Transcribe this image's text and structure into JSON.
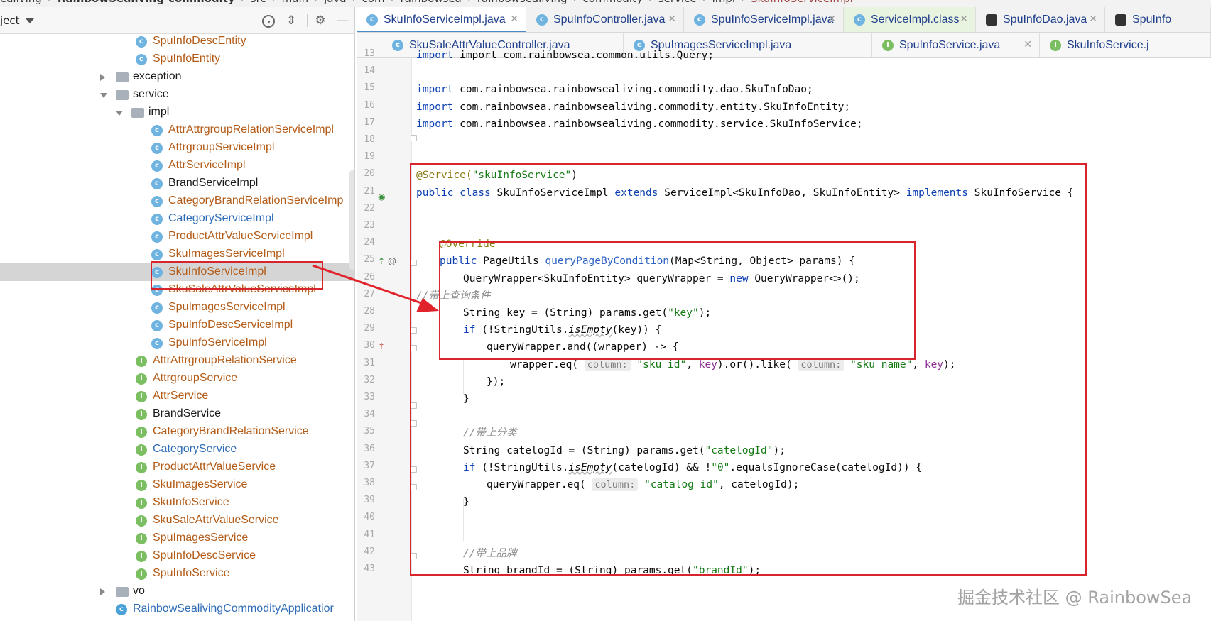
{
  "breadcrumb": [
    "ealiving",
    "RainbowSealiving-commodity",
    "src",
    "main",
    "java",
    "com",
    "rainbowsea",
    "rainbowsealiving",
    "commodity",
    "service",
    "impl",
    "SkuInfoServiceImpl"
  ],
  "project_panel": {
    "title": "ject",
    "icons": [
      "locate-icon",
      "collapse-all-icon",
      "gear-icon",
      "minimize-icon"
    ],
    "tree": [
      {
        "label": "SpuInfoDescEntity",
        "type": "class",
        "depth": 3,
        "style": "modified"
      },
      {
        "label": "SpuInfoEntity",
        "type": "class",
        "depth": 3,
        "style": "modified"
      },
      {
        "label": "exception",
        "type": "folder",
        "depth": 1,
        "expanded": false,
        "style": "normal"
      },
      {
        "label": "service",
        "type": "folder",
        "depth": 1,
        "expanded": true,
        "style": "normal"
      },
      {
        "label": "impl",
        "type": "folder",
        "depth": 2,
        "expanded": true,
        "style": "normal"
      },
      {
        "label": "AttrAttrgroupRelationServiceImpl",
        "type": "class",
        "depth": 4,
        "style": "modified"
      },
      {
        "label": "AttrgroupServiceImpl",
        "type": "class",
        "depth": 4,
        "style": "modified"
      },
      {
        "label": "AttrServiceImpl",
        "type": "class",
        "depth": 4,
        "style": "modified"
      },
      {
        "label": "BrandServiceImpl",
        "type": "class",
        "depth": 4,
        "style": "normal"
      },
      {
        "label": "CategoryBrandRelationServiceImp",
        "type": "class",
        "depth": 4,
        "style": "modified"
      },
      {
        "label": "CategoryServiceImpl",
        "type": "class",
        "depth": 4,
        "style": "added"
      },
      {
        "label": "ProductAttrValueServiceImpl",
        "type": "class",
        "depth": 4,
        "style": "modified"
      },
      {
        "label": "SkuImagesServiceImpl",
        "type": "class",
        "depth": 4,
        "style": "modified"
      },
      {
        "label": "SkuInfoServiceImpl",
        "type": "class",
        "depth": 4,
        "style": "modified",
        "selected": true
      },
      {
        "label": "SkuSaleAttrValueServiceImpl",
        "type": "class",
        "depth": 4,
        "style": "modified"
      },
      {
        "label": "SpuImagesServiceImpl",
        "type": "class",
        "depth": 4,
        "style": "modified"
      },
      {
        "label": "SpuInfoDescServiceImpl",
        "type": "class",
        "depth": 4,
        "style": "modified"
      },
      {
        "label": "SpuInfoServiceImpl",
        "type": "class",
        "depth": 4,
        "style": "modified"
      },
      {
        "label": "AttrAttrgroupRelationService",
        "type": "iface",
        "depth": 3,
        "style": "modified"
      },
      {
        "label": "AttrgroupService",
        "type": "iface",
        "depth": 3,
        "style": "modified"
      },
      {
        "label": "AttrService",
        "type": "iface",
        "depth": 3,
        "style": "modified"
      },
      {
        "label": "BrandService",
        "type": "iface",
        "depth": 3,
        "style": "normal"
      },
      {
        "label": "CategoryBrandRelationService",
        "type": "iface",
        "depth": 3,
        "style": "modified"
      },
      {
        "label": "CategoryService",
        "type": "iface",
        "depth": 3,
        "style": "added"
      },
      {
        "label": "ProductAttrValueService",
        "type": "iface",
        "depth": 3,
        "style": "modified"
      },
      {
        "label": "SkuImagesService",
        "type": "iface",
        "depth": 3,
        "style": "modified"
      },
      {
        "label": "SkuInfoService",
        "type": "iface",
        "depth": 3,
        "style": "modified"
      },
      {
        "label": "SkuSaleAttrValueService",
        "type": "iface",
        "depth": 3,
        "style": "modified"
      },
      {
        "label": "SpuImagesService",
        "type": "iface",
        "depth": 3,
        "style": "modified"
      },
      {
        "label": "SpuInfoDescService",
        "type": "iface",
        "depth": 3,
        "style": "modified"
      },
      {
        "label": "SpuInfoService",
        "type": "iface",
        "depth": 3,
        "style": "modified"
      },
      {
        "label": "vo",
        "type": "folder",
        "depth": 1,
        "expanded": false,
        "style": "normal"
      },
      {
        "label": "RainbowSealivingCommodityApplicatior",
        "type": "app",
        "depth": 1,
        "style": "added"
      }
    ]
  },
  "tabs_row1": [
    {
      "label": "SkuInfoServiceImpl.java",
      "icon": "class",
      "active": true,
      "close": true
    },
    {
      "label": "SpuInfoController.java",
      "icon": "class",
      "close": true
    },
    {
      "label": "SpuInfoServiceImpl.java",
      "icon": "class",
      "close": true
    },
    {
      "label": "ServiceImpl.class",
      "icon": "class",
      "pinned": true,
      "close": true
    },
    {
      "label": "SpuInfoDao.java",
      "icon": "db",
      "close": true
    },
    {
      "label": "SpuInfo",
      "icon": "db",
      "close": false
    }
  ],
  "tabs_row2": [
    {
      "label": "SkuSaleAttrValueController.java",
      "icon": "class",
      "close": false
    },
    {
      "label": "SpuImagesServiceImpl.java",
      "icon": "class",
      "close": false
    },
    {
      "label": "SpuInfoService.java",
      "icon": "iface",
      "close": true
    },
    {
      "label": "SkuInfoService.j",
      "icon": "iface",
      "close": false
    }
  ],
  "editor": {
    "top_partial": "import com.rainbowsea.common.utils.Query;",
    "line_numbers": [
      "13",
      "14",
      "15",
      "16",
      "17",
      "18",
      "19",
      "20",
      "21",
      "22",
      "23",
      "24",
      "25",
      "26",
      "27",
      "28",
      "29",
      "30",
      "31",
      "32",
      "33",
      "34",
      "35",
      "36",
      "37",
      "38",
      "39",
      "40",
      "41",
      "42",
      "43"
    ],
    "strings": {
      "import": "import",
      "pkg_dao": "com.rainbowsea.rainbowsealiving.commodity.dao.SkuInfoDao;",
      "pkg_entity": "com.rainbowsea.rainbowsealiving.commodity.entity.SkuInfoEntity;",
      "pkg_service": "com.rainbowsea.rainbowsealiving.commodity.service.SkuInfoService;",
      "ann_service": "@Service(",
      "str_skuinfoservice": "\"skuInfoService\"",
      "close_paren": ")",
      "public": "public",
      "class": "class",
      "class_name": "SkuInfoServiceImpl",
      "extends": "extends",
      "super": "ServiceImpl<SkuInfoDao, SkuInfoEntity>",
      "implements": "implements",
      "iface": "SkuInfoService {",
      "ann_override": "@Override",
      "ret_type": "PageUtils",
      "method_name": "queryPageByCondition",
      "method_params": "(Map<String, Object> params) {",
      "qw_decl": "QueryWrapper<SkuInfoEntity> queryWrapper = ",
      "new": "new",
      "qw_new": " QueryWrapper<>();",
      "cmt_query": "//带上查询条件",
      "key_decl": "String key = (String) params.get(",
      "str_key": "\"key\"",
      "semi_close": ");",
      "if": "if",
      "if_open": " (!StringUtils.",
      "is_empty": "isEmpty",
      "if_key_rest": "(key)) {",
      "qw_and": "queryWrapper.and((wrapper) -> {",
      "wrapper_eq": "wrapper.eq(",
      "hint_column": "column:",
      "str_sku_id": "\"sku_id\"",
      "comma": ", ",
      "key": "key",
      "or_like": ").or().like(",
      "str_sku_name": "\"sku_name\"",
      "close_lambda": "});",
      "close_brace": "}",
      "cmt_catalog": "//带上分类",
      "catelog_decl": "String catelogId = (String) params.get(",
      "str_catelogid": "\"catelogId\"",
      "if_cat_rest": "(catelogId) && !",
      "str_zero": "\"0\"",
      "equals_ignore": ".equalsIgnoreCase(catelogId)) {",
      "qw_eq": "queryWrapper.eq(",
      "str_catalog_id": "\"catalog_id\"",
      "catelog_rest": ", catelogId);",
      "cmt_brand": "//带上品牌",
      "brand_decl": "String brandId = (String) params.get(",
      "str_brandid": "\"brandId\""
    }
  },
  "watermark": "掘金技术社区 @ RainbowSea",
  "colors": {
    "annotation_red": "#d8242c",
    "keyword": "#0b3fb3",
    "string": "#157a15",
    "modified_file": "#b35b17",
    "added_file": "#2e6cb7"
  }
}
